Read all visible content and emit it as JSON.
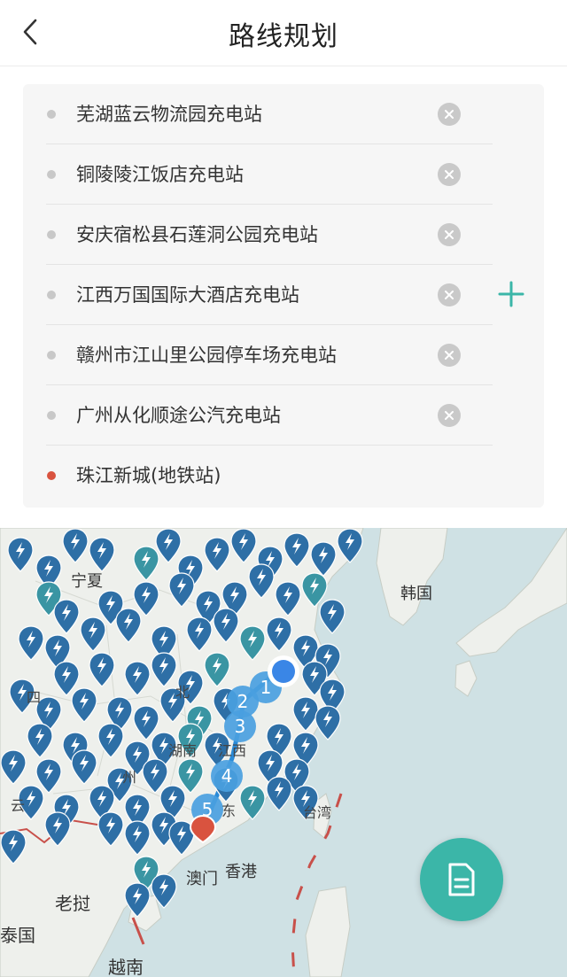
{
  "header": {
    "title": "路线规划"
  },
  "route": {
    "stops": [
      {
        "label": "芜湖蓝云物流园充电站",
        "type": "waypoint"
      },
      {
        "label": "铜陵陵江饭店充电站",
        "type": "waypoint"
      },
      {
        "label": "安庆宿松县石莲洞公园充电站",
        "type": "waypoint"
      },
      {
        "label": "江西万国国际大酒店充电站",
        "type": "waypoint"
      },
      {
        "label": "赣州市江山里公园停车场充电站",
        "type": "waypoint"
      },
      {
        "label": "广州从化顺途公汽充电站",
        "type": "waypoint"
      },
      {
        "label": "珠江新城(地铁站)",
        "type": "destination"
      }
    ]
  },
  "map": {
    "labels": {
      "ningxia": "宁夏",
      "korea": "韩国",
      "si": "四",
      "bei": "北",
      "hunan": "湖南",
      "jiangxi": "江西",
      "zhou": "州",
      "yun": "云",
      "dong": "东",
      "taiwan": "台湾",
      "macau": "澳门",
      "hongkong": "香港",
      "laos": "老挝",
      "thailand": "泰国",
      "vietnam": "越南"
    },
    "route_markers": [
      "1",
      "2",
      "3",
      "4",
      "5"
    ],
    "icons": {
      "station": "charging-station-pin-icon",
      "report": "document-icon"
    }
  },
  "colors": {
    "accent": "#3bb6a8",
    "station_pin": "#2e6fa6",
    "route_marker": "#4a9fe0",
    "destination": "#d9533f",
    "sea": "#cfe1e4",
    "land": "#eef0ec"
  }
}
